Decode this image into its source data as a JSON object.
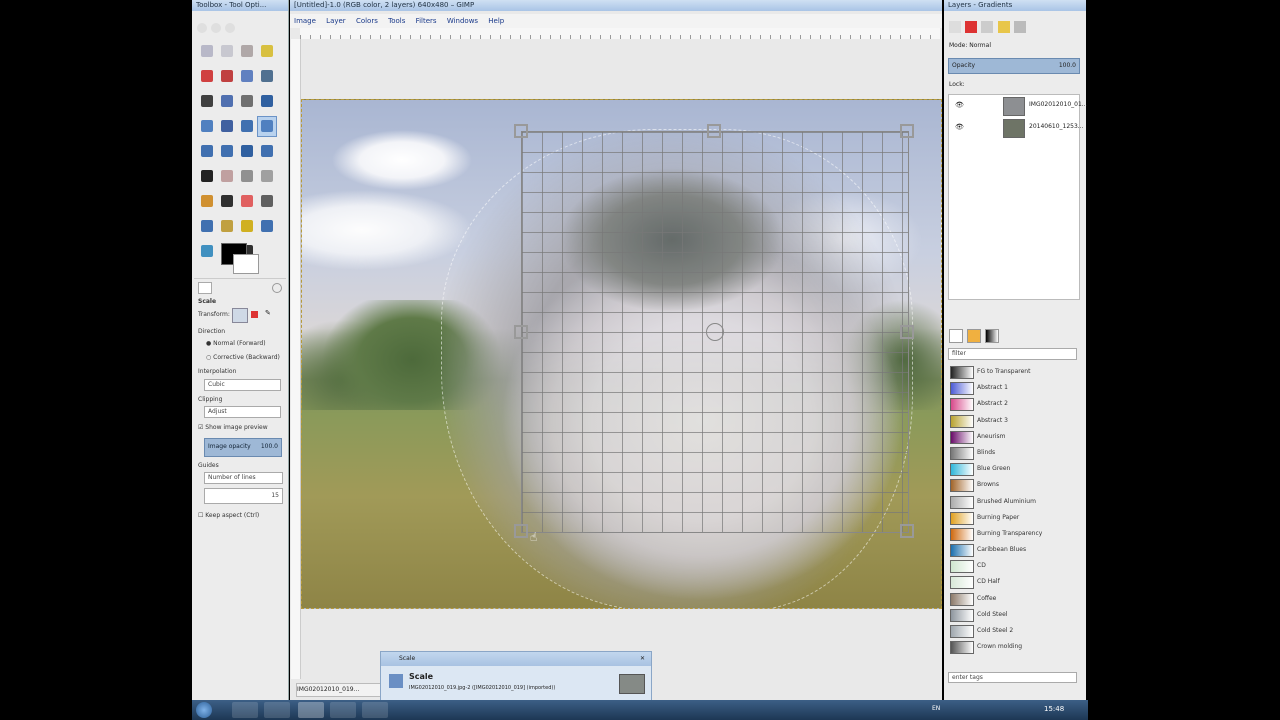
{
  "toolbox": {
    "title": "Toolbox - Tool Opti...",
    "tool_icons": [
      "rect-select",
      "ellipse-select",
      "free-select",
      "fuzzy-select",
      "select-by-color",
      "scissors",
      "foreground-select",
      "paths",
      "color-picker",
      "zoom",
      "measure",
      "move",
      "align",
      "crop",
      "rotate",
      "scale",
      "shear",
      "perspective",
      "flip",
      "cage",
      "text",
      "heal",
      "clone",
      "blur",
      "pencil",
      "paintbrush",
      "eraser",
      "airbrush",
      "ink",
      "smudge",
      "dodge",
      "bucket-fill",
      "blend",
      "convolve",
      "perspective-clone"
    ],
    "options": {
      "tool_name": "Scale",
      "transform_label": "Transform:",
      "direction_label": "Direction",
      "direction_normal": "Normal (Forward)",
      "direction_corrective": "Corrective (Backward)",
      "interpolation_label": "Interpolation",
      "interpolation_value": "Cubic",
      "clipping_label": "Clipping",
      "clipping_value": "Adjust",
      "show_preview": "Show image preview",
      "image_opacity_label": "Image opacity",
      "image_opacity_value": "100.0",
      "guides_label": "Guides",
      "guides_value": "Number of lines",
      "lines_value": "15",
      "keep_aspect": "Keep aspect (Ctrl)"
    }
  },
  "image_window": {
    "title": "[Untitled]-1.0 (RGB color, 2 layers) 640x480 – GIMP",
    "menus": [
      "Image",
      "Layer",
      "Colors",
      "Tools",
      "Filters",
      "Windows",
      "Help"
    ],
    "status_text": "IMG02012010_019..."
  },
  "layers": {
    "title": "Layers - Gradients",
    "mode_label": "Mode: Normal",
    "opacity_label": "Opacity",
    "opacity_value": "100.0",
    "lock_label": "Lock:",
    "items": [
      {
        "name": "IMG02012010_01..."
      },
      {
        "name": "20140610_1253..."
      }
    ]
  },
  "gradients": {
    "filter_placeholder": "filter",
    "items": [
      {
        "name": "FG to Transparent",
        "color": "#222222"
      },
      {
        "name": "Abstract 1",
        "color": "#4c5bd6"
      },
      {
        "name": "Abstract 2",
        "color": "#d84a8b"
      },
      {
        "name": "Abstract 3",
        "color": "#b8a230"
      },
      {
        "name": "Aneurism",
        "color": "#6a0c6a"
      },
      {
        "name": "Blinds",
        "color": "#777777"
      },
      {
        "name": "Blue Green",
        "color": "#2fb6d9"
      },
      {
        "name": "Browns",
        "color": "#a2652a"
      },
      {
        "name": "Brushed Aluminium",
        "color": "#aaaaaa"
      },
      {
        "name": "Burning Paper",
        "color": "#e0a020"
      },
      {
        "name": "Burning Transparency",
        "color": "#d06a10"
      },
      {
        "name": "Caribbean Blues",
        "color": "#1b6fae"
      },
      {
        "name": "CD",
        "color": "#cfe6cf"
      },
      {
        "name": "CD Half",
        "color": "#d8e8d8"
      },
      {
        "name": "Coffee",
        "color": "#8c7a6a"
      },
      {
        "name": "Cold Steel",
        "color": "#8e969e"
      },
      {
        "name": "Cold Steel 2",
        "color": "#9fa7ae"
      },
      {
        "name": "Crown molding",
        "color": "#555555"
      }
    ],
    "tag_placeholder": "enter tags"
  },
  "scale_dialog": {
    "title": "Scale",
    "heading": "Scale",
    "subtitle": "IMG02012010_019.jpg-2 ([IMG02012010_019] (imported))"
  },
  "taskbar": {
    "lang": "EN",
    "clock": "15:48"
  }
}
